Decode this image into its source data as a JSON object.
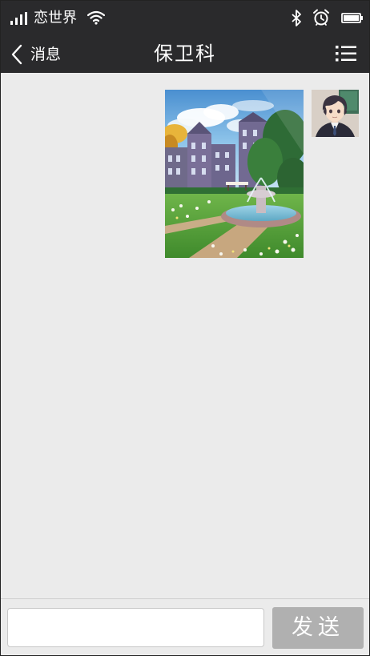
{
  "status_bar": {
    "carrier": "恋世界",
    "icons": [
      "signal-icon",
      "wifi-icon",
      "bluetooth-icon",
      "alarm-icon",
      "battery-icon"
    ]
  },
  "nav": {
    "back_label": "消息",
    "title": "保卫科",
    "back_icon": "chevron-left-icon",
    "menu_icon": "list-menu-icon"
  },
  "messages": [
    {
      "type": "image",
      "direction": "outgoing",
      "content": "campus-garden-fountain-illustration"
    }
  ],
  "input": {
    "value": "",
    "placeholder": ""
  },
  "send_button": {
    "label": "发送"
  },
  "colors": {
    "bar_background": "#2a2a2c",
    "chat_background": "#ebebeb",
    "send_button": "#b0b0b0"
  }
}
